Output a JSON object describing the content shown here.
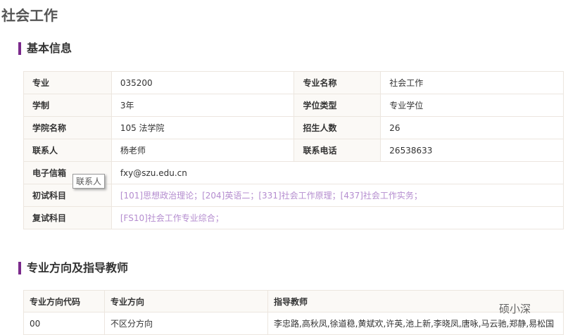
{
  "title": "社会工作",
  "basic": {
    "heading": "基本信息",
    "rows": [
      [
        "专业",
        "035200",
        "专业名称",
        "社会工作"
      ],
      [
        "学制",
        "3年",
        "学位类型",
        "专业学位"
      ],
      [
        "学院名称",
        "105 法学院",
        "招生人数",
        "26"
      ],
      [
        "联系人",
        "杨老师",
        "联系电话",
        "26538633"
      ]
    ],
    "email_label": "电子信箱",
    "email": "fxy@szu.edu.cn",
    "exam1_label": "初试科目",
    "exam1": "[101]思想政治理论；[204]英语二；[331]社会工作原理；[437]社会工作实务；",
    "exam2_label": "复试科目",
    "exam2": "[FS10]社会工作专业综合；",
    "tooltip": "联系人"
  },
  "directions": {
    "heading": "专业方向及指导教师",
    "headers": [
      "专业方向代码",
      "专业方向",
      "指导教师"
    ],
    "rows": [
      [
        "00",
        "不区分方向",
        "李忠路,高秋凤,徐道稳,黄斌欢,许英,池上新,李晓凤,唐咏,马云驰,郑静,易松国"
      ]
    ]
  },
  "watermark": "硕小深"
}
